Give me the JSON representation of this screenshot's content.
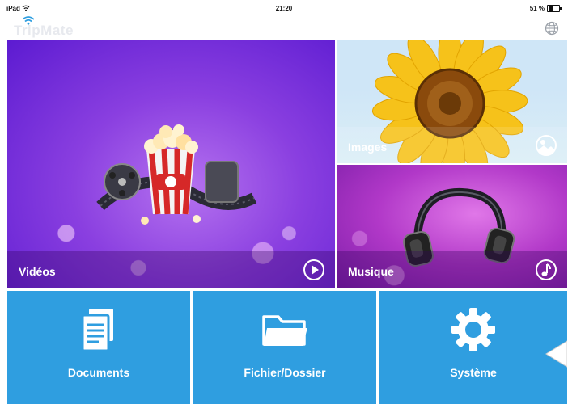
{
  "status": {
    "device": "iPad",
    "time": "21:20",
    "battery": "51 %"
  },
  "app": {
    "name": "TripMate"
  },
  "tiles": {
    "videos": {
      "label": "Vidéos"
    },
    "images": {
      "label": "Images"
    },
    "music": {
      "label": "Musique"
    },
    "documents": {
      "label": "Documents"
    },
    "folder": {
      "label": "Fichier/Dossier"
    },
    "system": {
      "label": "Système"
    }
  },
  "icons": {
    "status_wifi": "wifi-icon",
    "logo_wifi": "wifi-icon",
    "globe": "globe-icon",
    "play": "play-icon",
    "images": "photo-icon",
    "music": "music-note-icon",
    "documents": "documents-icon",
    "folder": "folder-icon",
    "system": "gear-icon",
    "side": "arrow-left-icon"
  },
  "colors": {
    "tile_blue": "#2f9ee0",
    "video_purple": "#8a3fe0",
    "music_magenta": "#b138c8"
  }
}
